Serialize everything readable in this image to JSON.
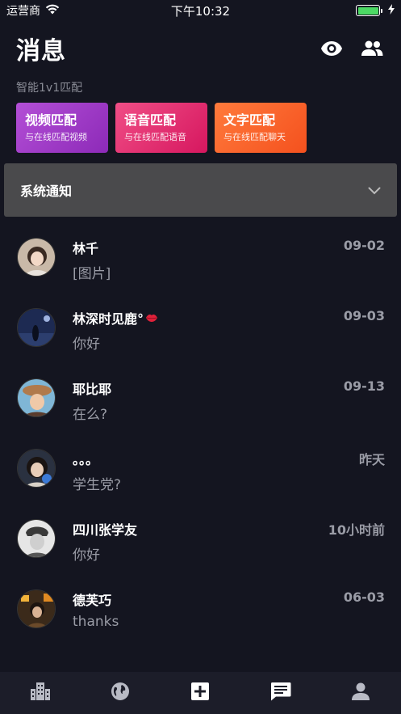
{
  "status_bar": {
    "carrier": "运营商",
    "time": "下午10:32",
    "battery_level": 1.0
  },
  "header": {
    "title": "消息",
    "icons": [
      "eye-icon",
      "users-icon"
    ]
  },
  "match": {
    "label": "智能1v1匹配",
    "cards": [
      {
        "title": "视频匹配",
        "subtitle": "与在线匹配视频",
        "color": "#a13bc9"
      },
      {
        "title": "语音匹配",
        "subtitle": "与在线匹配语音",
        "color": "#e3306f"
      },
      {
        "title": "文字匹配",
        "subtitle": "与在线匹配聊天",
        "color": "#f9632b"
      }
    ]
  },
  "system_notice": {
    "title": "系统通知",
    "icon": "chevron-down-icon"
  },
  "conversations": [
    {
      "name": "林千",
      "preview": "[图片]",
      "time": "09-02",
      "badge": ""
    },
    {
      "name": "林深时见鹿°",
      "preview": "你好",
      "time": "09-03",
      "badge": "lips-icon"
    },
    {
      "name": "耶比耶",
      "preview": "在么?",
      "time": "09-13",
      "badge": ""
    },
    {
      "name": "。。。",
      "preview": "学生党?",
      "time": "昨天",
      "badge": ""
    },
    {
      "name": "四川张学友",
      "preview": "你好",
      "time": "10小时前",
      "badge": ""
    },
    {
      "name": "德芙巧",
      "preview": "thanks",
      "time": "06-03",
      "badge": ""
    }
  ],
  "tab_bar": {
    "tabs": [
      "city-icon",
      "globe-icon",
      "add-icon",
      "message-icon",
      "profile-icon"
    ],
    "active_index": 3
  },
  "colors": {
    "background": "#141520",
    "tab_bar": "#1c1d29",
    "notice": "#4a4a4c",
    "muted_text": "#9a9ca6"
  }
}
